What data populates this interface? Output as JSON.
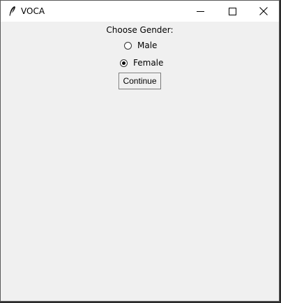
{
  "window": {
    "title": "VOCA",
    "icon": "feather-icon"
  },
  "controls": {
    "minimize_icon": "minimize-icon",
    "maximize_icon": "maximize-icon",
    "close_icon": "close-icon"
  },
  "content": {
    "prompt": "Choose Gender:",
    "options": [
      {
        "label": "Male",
        "selected": false
      },
      {
        "label": "Female",
        "selected": true
      }
    ],
    "continue_label": "Continue"
  }
}
